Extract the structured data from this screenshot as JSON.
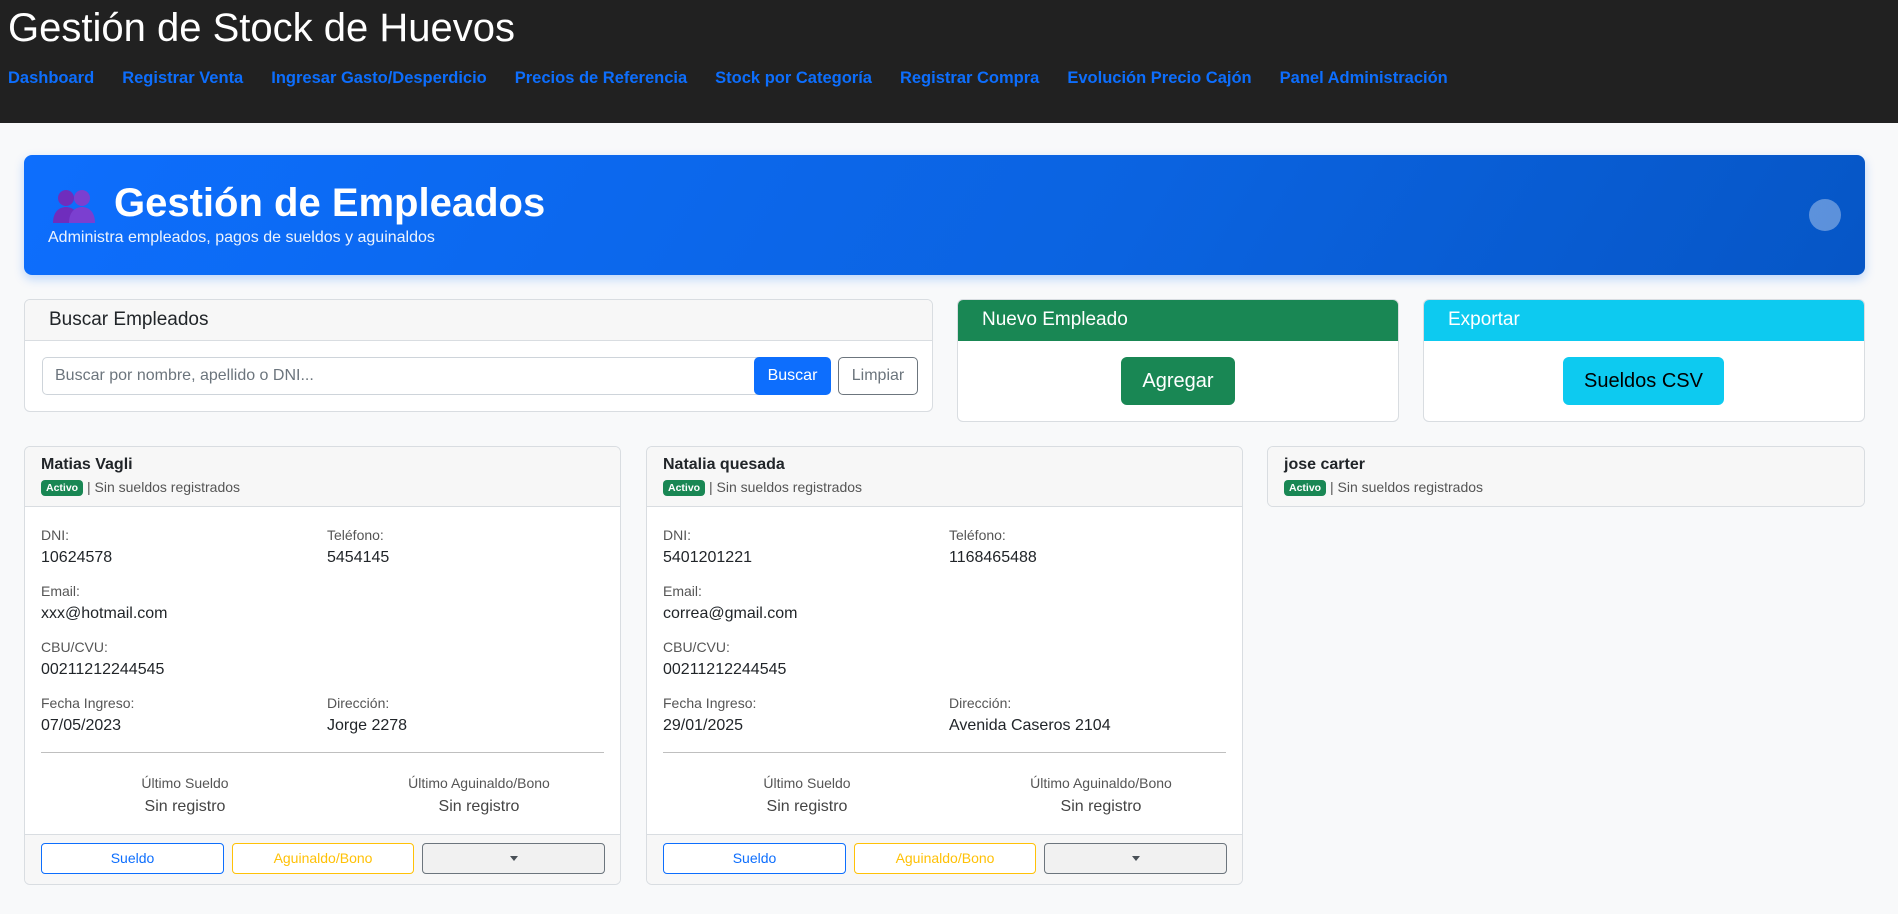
{
  "app": {
    "title": "Gestión de Stock de Huevos",
    "nav": [
      "Dashboard",
      "Registrar Venta",
      "Ingresar Gasto/Desperdicio",
      "Precios de Referencia",
      "Stock por Categoría",
      "Registrar Compra",
      "Evolución Precio Cajón",
      "Panel Administración"
    ]
  },
  "hero": {
    "icon": "users-icon",
    "title": "Gestión de Empleados",
    "subtitle": "Administra empleados, pagos de sueldos y aguinaldos"
  },
  "search": {
    "title": "Buscar Empleados",
    "placeholder": "Buscar por nombre, apellido o DNI...",
    "search_label": "Buscar",
    "clear_label": "Limpiar"
  },
  "new_employee": {
    "title": "Nuevo Empleado",
    "button_label": "Agregar"
  },
  "export": {
    "title": "Exportar",
    "button_label": "Sueldos CSV"
  },
  "labels": {
    "dni": "DNI:",
    "phone": "Teléfono:",
    "email": "Email:",
    "cbu": "CBU/CVU:",
    "hire_date": "Fecha Ingreso:",
    "address": "Dirección:",
    "last_salary": "Último Sueldo",
    "last_bonus": "Último Aguinaldo/Bono",
    "btn_salary": "Sueldo",
    "btn_bonus": "Aguinaldo/Bono"
  },
  "employees": [
    {
      "name": "Matias Vagli",
      "badge": "Activo",
      "status_text": "| Sin sueldos registrados",
      "dni": "10624578",
      "phone": "5454145",
      "email": "xxx@hotmail.com",
      "cbu": "00211212244545",
      "hire_date": "07/05/2023",
      "address": "Jorge 2278",
      "last_salary": "Sin registro",
      "last_bonus": "Sin registro"
    },
    {
      "name": "Natalia quesada",
      "badge": "Activo",
      "status_text": "| Sin sueldos registrados",
      "dni": "5401201221",
      "phone": "1168465488",
      "email": "correa@gmail.com",
      "cbu": "00211212244545",
      "hire_date": "29/01/2025",
      "address": "Avenida Caseros 2104",
      "last_salary": "Sin registro",
      "last_bonus": "Sin registro"
    },
    {
      "name": "jose carter",
      "badge": "Activo",
      "status_text": "| Sin sueldos registrados"
    }
  ],
  "colors": {
    "primary": "#0d6efd",
    "success": "#198754",
    "info": "#0dcaf0",
    "warning": "#ffc107",
    "topbar": "#212121"
  }
}
